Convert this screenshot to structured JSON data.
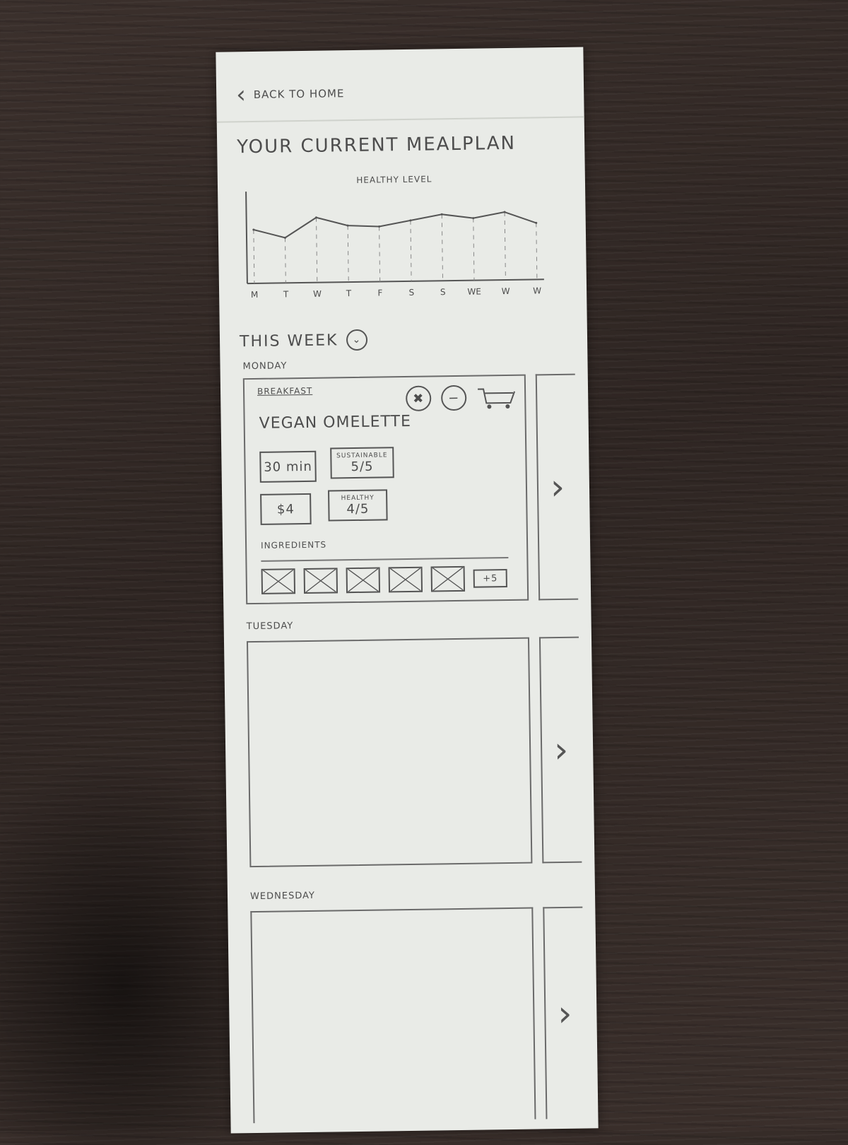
{
  "nav": {
    "back_label": "Back to home"
  },
  "page": {
    "title": "Your current mealplan"
  },
  "chart_data": {
    "type": "line",
    "title": "Healthy level",
    "categories": [
      "M",
      "T",
      "W",
      "T",
      "F",
      "S",
      "S",
      "WE",
      "W",
      "W"
    ],
    "values": [
      3.8,
      3.2,
      4.6,
      4.0,
      3.9,
      4.3,
      4.7,
      4.4,
      4.8,
      4.0
    ],
    "ylim": [
      0,
      6
    ],
    "grid": "vertical dashed"
  },
  "section": {
    "this_week_label": "This week"
  },
  "days": [
    {
      "label": "Monday",
      "meal_type": "Breakfast",
      "meal_name": "Vegan omelette",
      "time": "30 min",
      "sustainable_caption": "Sustainable",
      "sustainable": "5/5",
      "price": "$4",
      "healthy_caption": "Healthy",
      "healthy": "4/5",
      "ingredients_label": "Ingredients",
      "ingredients_more": "+5",
      "icons": [
        "nutrition-icon",
        "remove-icon",
        "cart-icon"
      ]
    },
    {
      "label": "Tuesday"
    },
    {
      "label": "Wednesday"
    }
  ]
}
